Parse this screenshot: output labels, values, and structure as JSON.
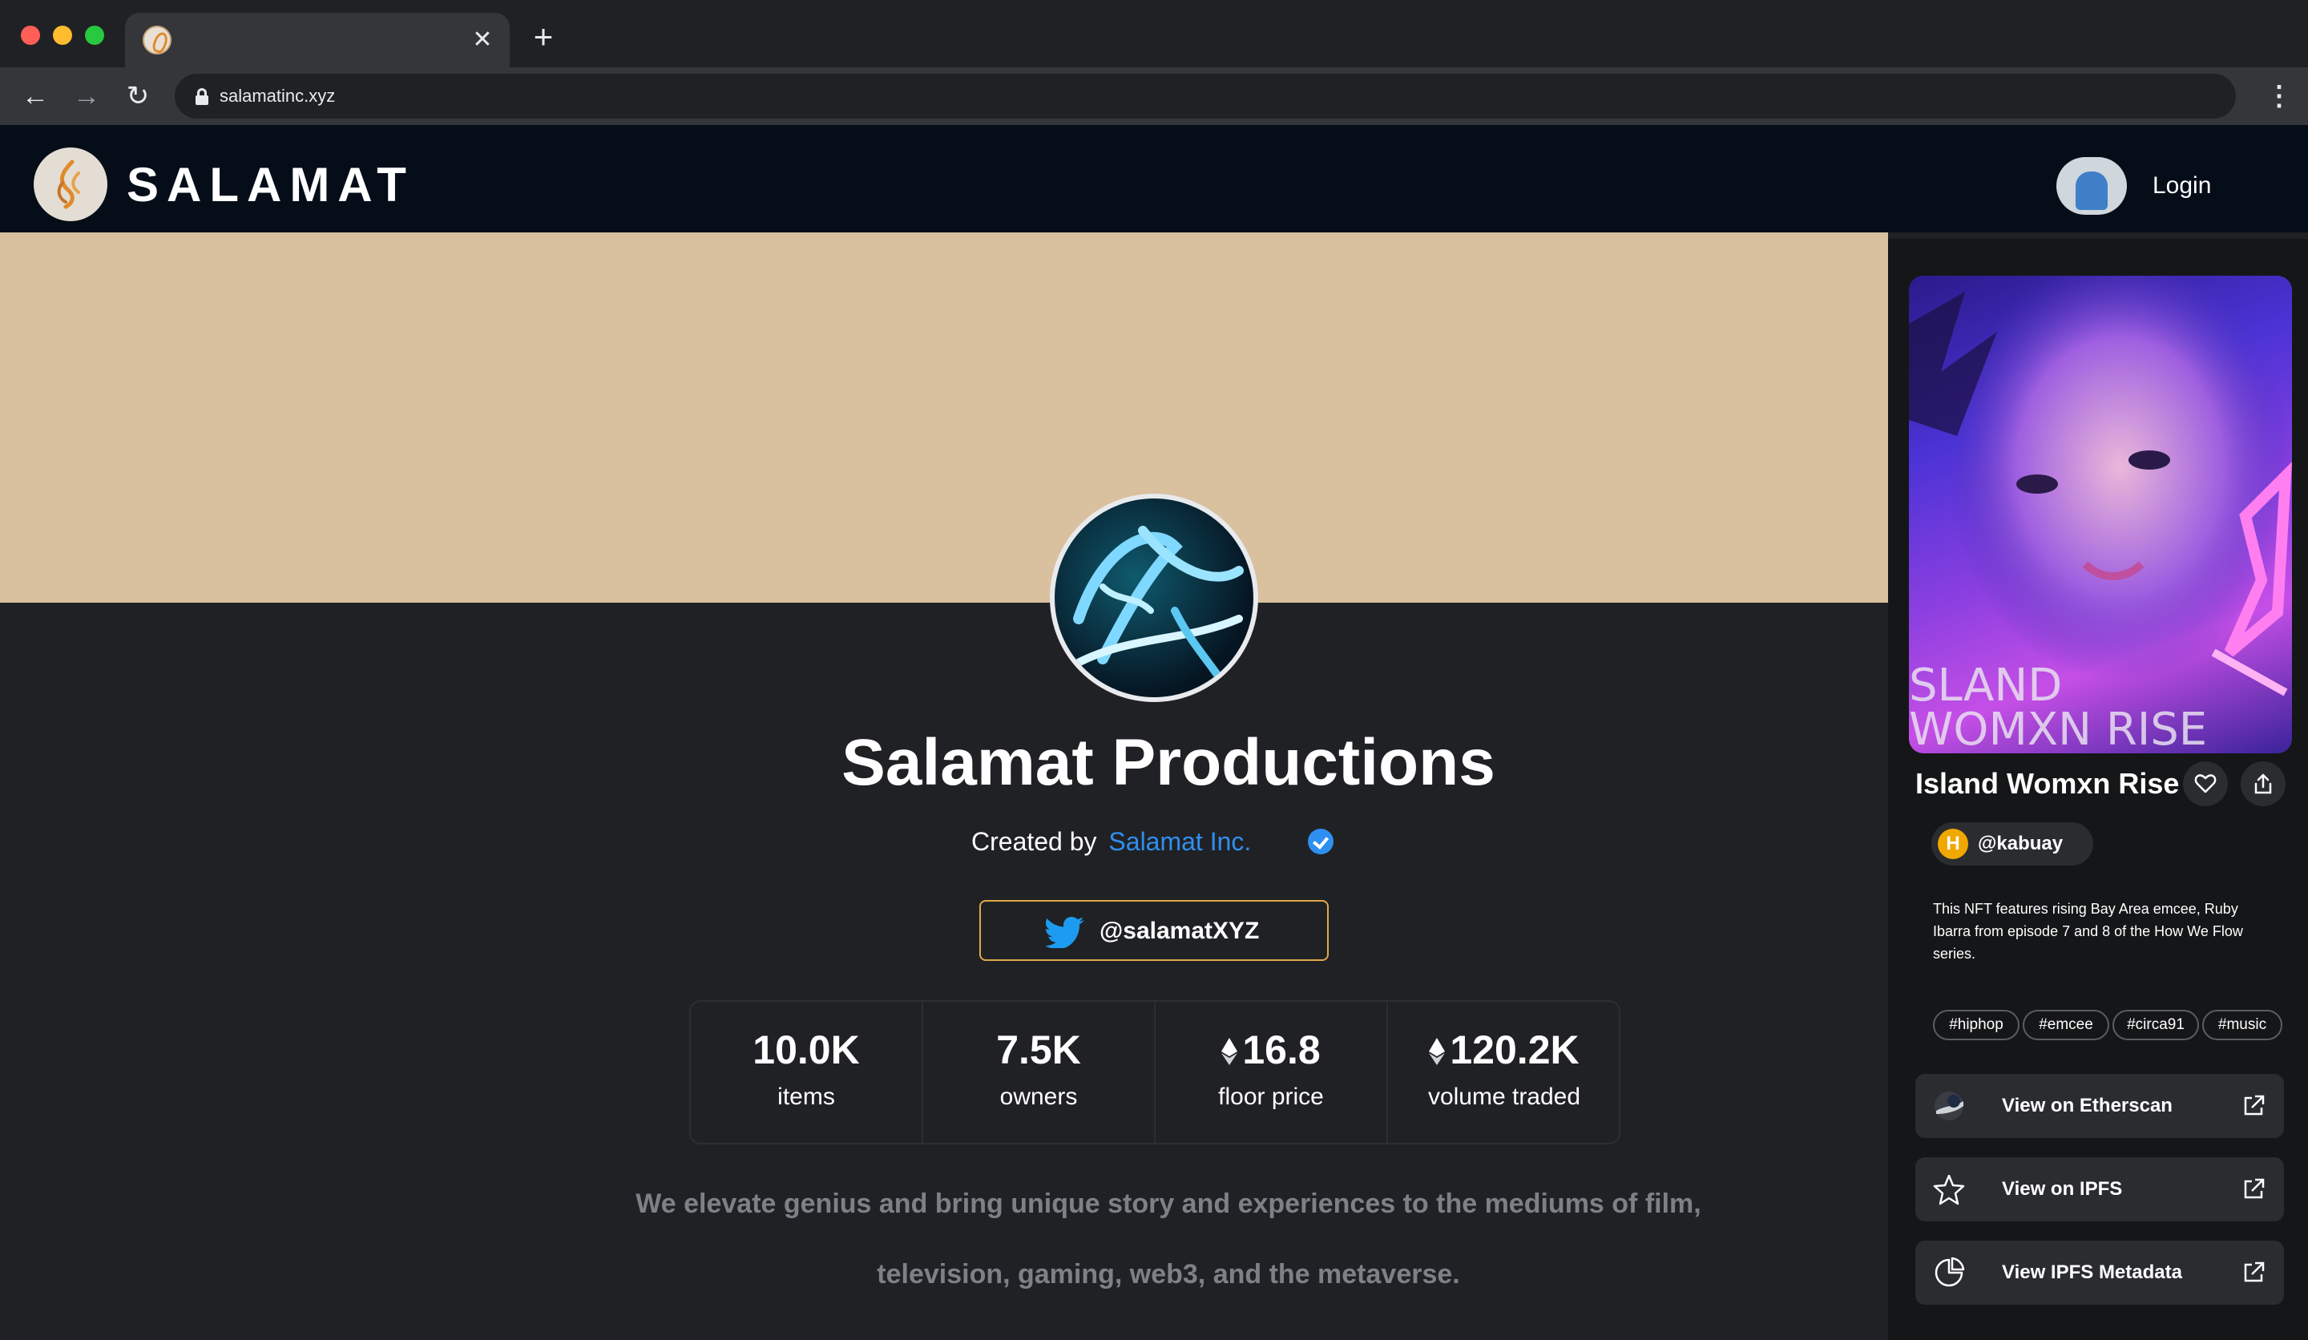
{
  "browser": {
    "url": "salamatinc.xyz",
    "tab_close": "✕",
    "new_tab": "+",
    "back": "←",
    "forward": "→",
    "reload": "↻",
    "menu": "⋮"
  },
  "header": {
    "brand": "SALAMAT",
    "login": "Login",
    "logo_icon": "salamat-flame-logo",
    "avatar_icon": "user-avatar"
  },
  "collection": {
    "title": "Salamat Productions",
    "created_by": "Created by",
    "creator": "Salamat Inc.",
    "twitter_handle": "@salamatXYZ",
    "stats": [
      {
        "value": "10.0K",
        "label": "items",
        "eth": false
      },
      {
        "value": "7.5K",
        "label": "owners",
        "eth": false
      },
      {
        "value": "16.8",
        "label": "floor price",
        "eth": true
      },
      {
        "value": "120.2K",
        "label": "volume traded",
        "eth": true
      }
    ],
    "description_line1": "We elevate genius and bring unique story and experiences to the mediums of film,",
    "description_line2": "television, gaming, web3, and the metaverse."
  },
  "nft": {
    "title": "Island Womxn Rise",
    "image_text_1": "SLAND",
    "image_text_2": "WOMXN RISE",
    "creator_initial": "H",
    "creator": "@kabuay",
    "description": "This NFT features rising Bay Area emcee, Ruby Ibarra from episode 7 and 8 of the How We Flow series.",
    "tags": [
      "#hiphop",
      "#emcee",
      "#circa91",
      "#music"
    ],
    "links": [
      {
        "label": "View on Etherscan",
        "icon": "etherscan-icon"
      },
      {
        "label": "View on IPFS",
        "icon": "star-icon"
      },
      {
        "label": "View IPFS Metadata",
        "icon": "pie-chart-icon"
      }
    ]
  },
  "colors": {
    "banner": "#d9c09f",
    "accent_link": "#2f8ff0",
    "twitter_border": "#e0a94a",
    "header_bg": "#050d18",
    "page_bg": "#202124"
  }
}
